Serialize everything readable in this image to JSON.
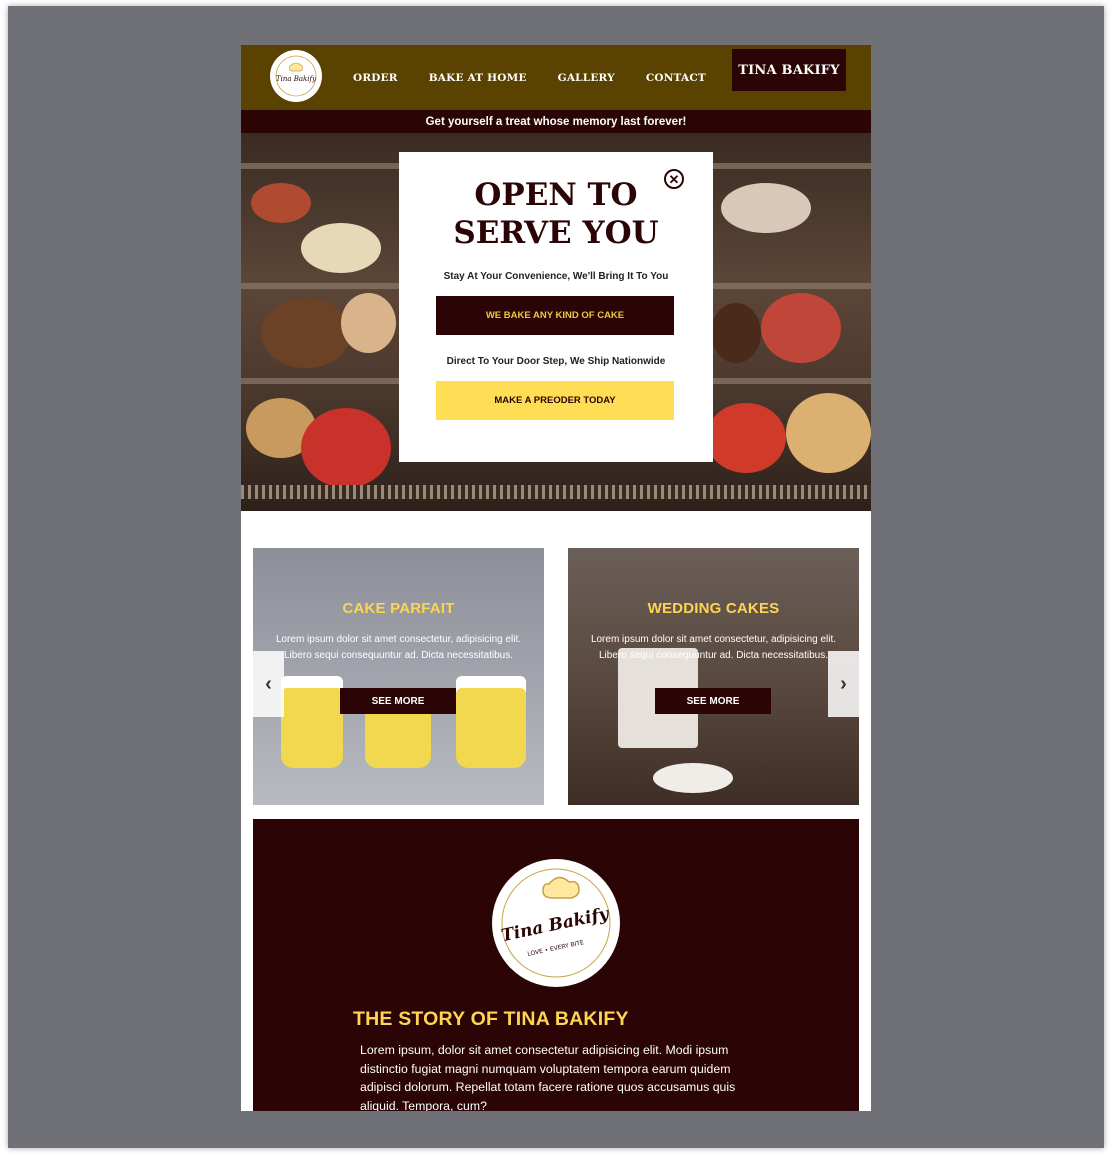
{
  "header": {
    "logo_text": "Tina Bakify",
    "nav": [
      "ORDER",
      "BAKE AT HOME",
      "GALLERY",
      "CONTACT"
    ],
    "brand_button": "TINA BAKIFY",
    "tagline": "Get yourself a treat whose memory last forever!"
  },
  "popup": {
    "title": "OPEN TO\nSERVE YOU",
    "line1": "Stay At Your Convenience, We'll Bring It To You",
    "button1": "WE BAKE ANY KIND OF CAKE",
    "line2": "Direct To Your Door Step, We Ship Nationwide",
    "button2": "MAKE A PREODER TODAY",
    "close_icon": "close-icon"
  },
  "cards": [
    {
      "title": "CAKE PARFAIT",
      "text": "Lorem ipsum dolor sit amet consectetur, adipisicing elit. Libero sequi consequuntur ad. Dicta necessitatibus.",
      "button": "SEE MORE"
    },
    {
      "title": "WEDDING CAKES",
      "text": "Lorem ipsum dolor sit amet consectetur, adipisicing elit. Libero sequi consequuntur ad. Dicta necessitatibus.",
      "button": "SEE MORE"
    }
  ],
  "carousel": {
    "prev_icon": "chevron-left-icon",
    "next_icon": "chevron-right-icon"
  },
  "story": {
    "logo_text": "Tina Bakify",
    "logo_subtext": "LOVE • EVERY BITE",
    "title": "THE STORY OF TINA BAKIFY",
    "text": "Lorem ipsum, dolor sit amet consectetur adipisicing elit. Modi ipsum distinctio fugiat magni numquam voluptatem tempora earum quidem adipisci dolorum. Repellat totam facere ratione quos accusamus quis aliquid. Tempora, cum?"
  },
  "colors": {
    "header_brown": "#5a4200",
    "dark_maroon": "#2b0505",
    "accent_yellow": "#ffd452",
    "button_yellow": "#ffdd55",
    "backdrop_gray": "#707176"
  }
}
